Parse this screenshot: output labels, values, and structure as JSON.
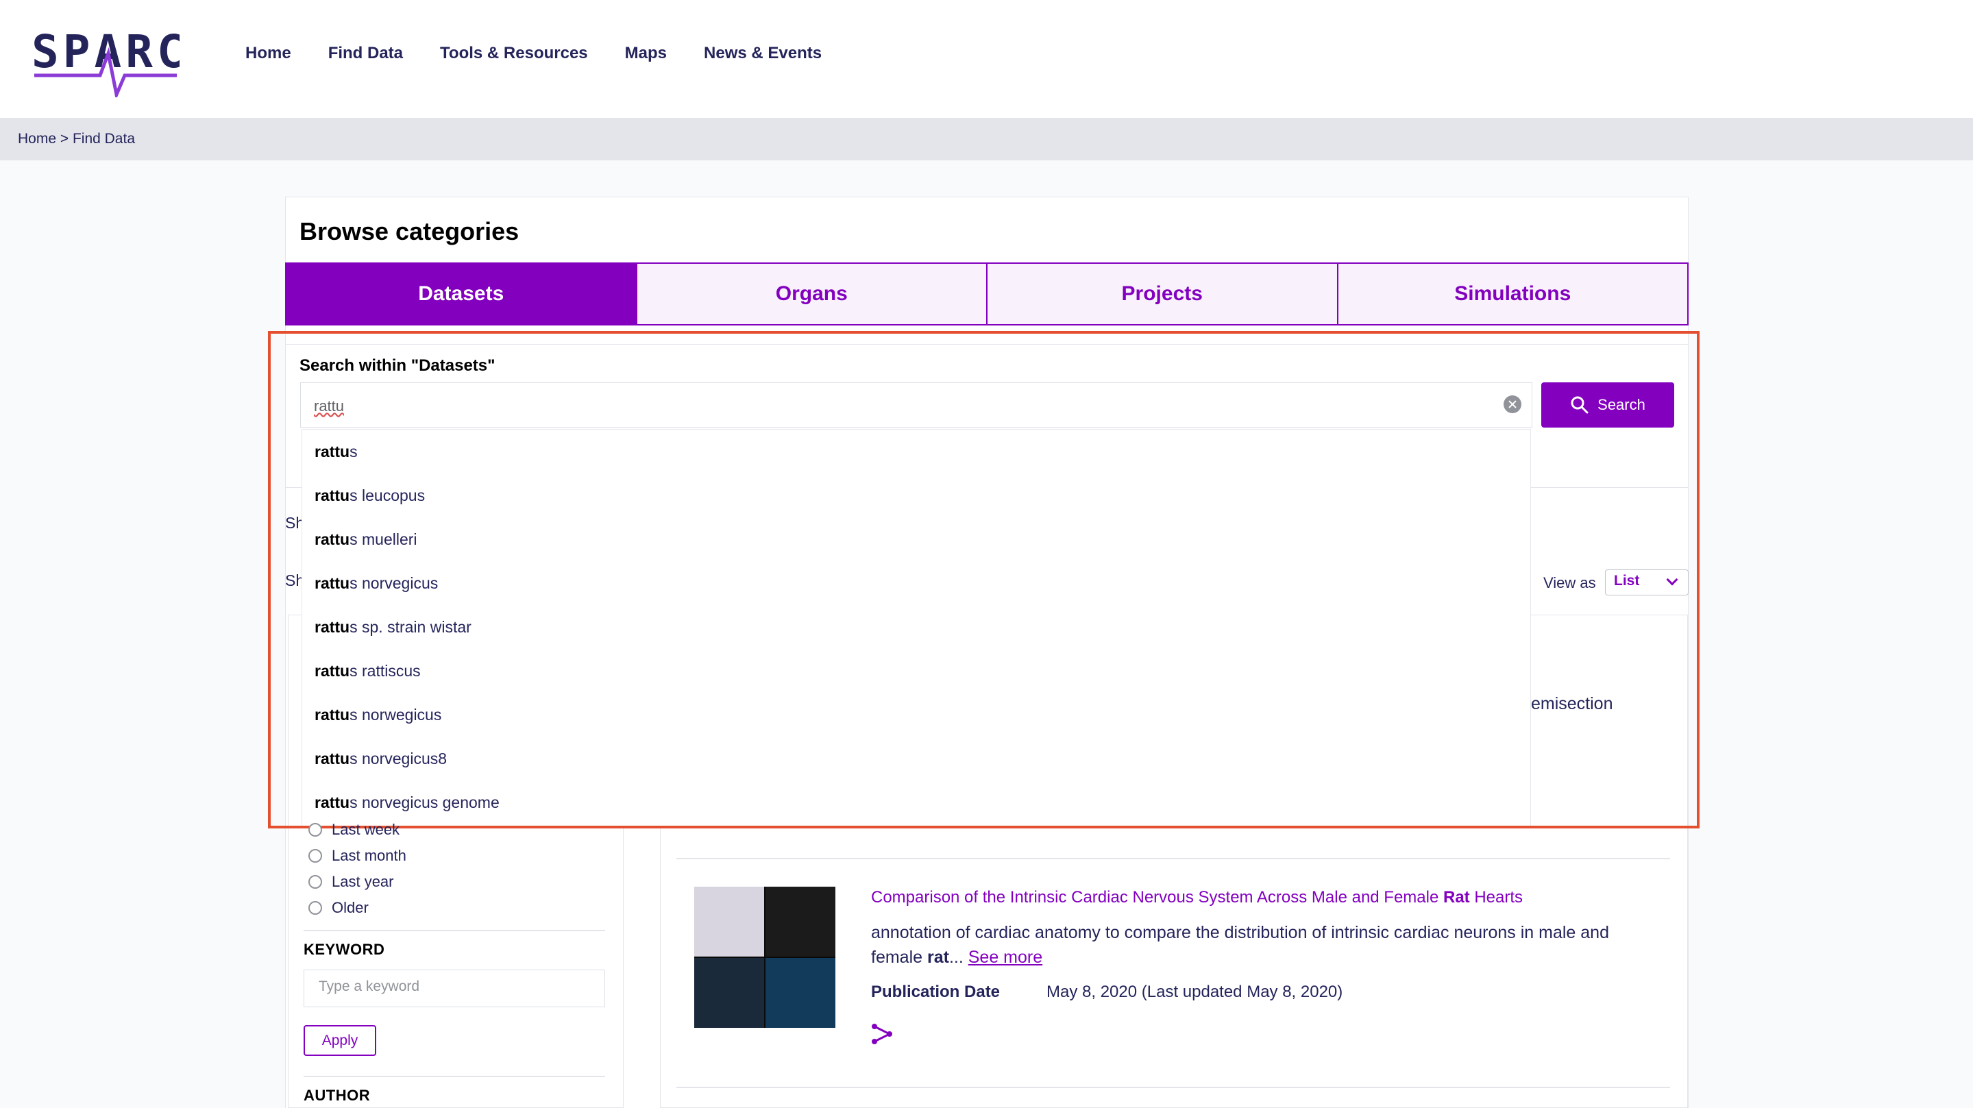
{
  "brand": {
    "logo_text": "SPARC",
    "accent": "#8300bf",
    "navy": "#24245b",
    "annotation": "#e4502f"
  },
  "nav": {
    "items": [
      {
        "label": "Home"
      },
      {
        "label": "Find Data"
      },
      {
        "label": "Tools & Resources"
      },
      {
        "label": "Maps"
      },
      {
        "label": "News & Events"
      }
    ]
  },
  "breadcrumb": {
    "text": "Home > Find Data"
  },
  "browse": {
    "title": "Browse categories",
    "tabs": [
      {
        "label": "Datasets",
        "active": true
      },
      {
        "label": "Organs",
        "active": false
      },
      {
        "label": "Projects",
        "active": false
      },
      {
        "label": "Simulations",
        "active": false
      }
    ]
  },
  "search": {
    "label": "Search within \"Datasets\"",
    "value": "rattu",
    "button_label": "Search",
    "suggestions": [
      {
        "match": "rattu",
        "rest": "s"
      },
      {
        "match": "rattu",
        "rest": "s leucopus"
      },
      {
        "match": "rattu",
        "rest": "s muelleri"
      },
      {
        "match": "rattu",
        "rest": "s norvegicus"
      },
      {
        "match": "rattu",
        "rest": "s sp. strain wistar"
      },
      {
        "match": "rattu",
        "rest": "s rattiscus"
      },
      {
        "match": "rattu",
        "rest": "s norwegicus"
      },
      {
        "match": "rattu",
        "rest": "s norvegicus8"
      },
      {
        "match": "rattu",
        "rest": "s norvegicus genome"
      }
    ]
  },
  "peeks": {
    "sh1": "Sh",
    "sh2": "Sh",
    "hemisection": "emisection",
    "view_as": "View as",
    "view_value": "List",
    "last_week": "Last week"
  },
  "filters": {
    "date_options": [
      "Last month",
      "Last year",
      "Older"
    ],
    "keyword_title": "KEYWORD",
    "keyword_placeholder": "Type a keyword",
    "apply_label": "Apply",
    "author_title": "AUTHOR"
  },
  "result": {
    "title_before": "Comparison of the Intrinsic Cardiac Nervous System Across Male and Female ",
    "title_bold": "Rat",
    "title_after": " Hearts",
    "desc_before": "annotation of cardiac anatomy to compare the distribution of intrinsic cardiac neurons in male and female ",
    "desc_bold": "rat",
    "desc_after": "... ",
    "see_more": "See more",
    "pub_label": "Publication Date",
    "pub_value": "May 8, 2020 (Last updated May 8, 2020)"
  }
}
